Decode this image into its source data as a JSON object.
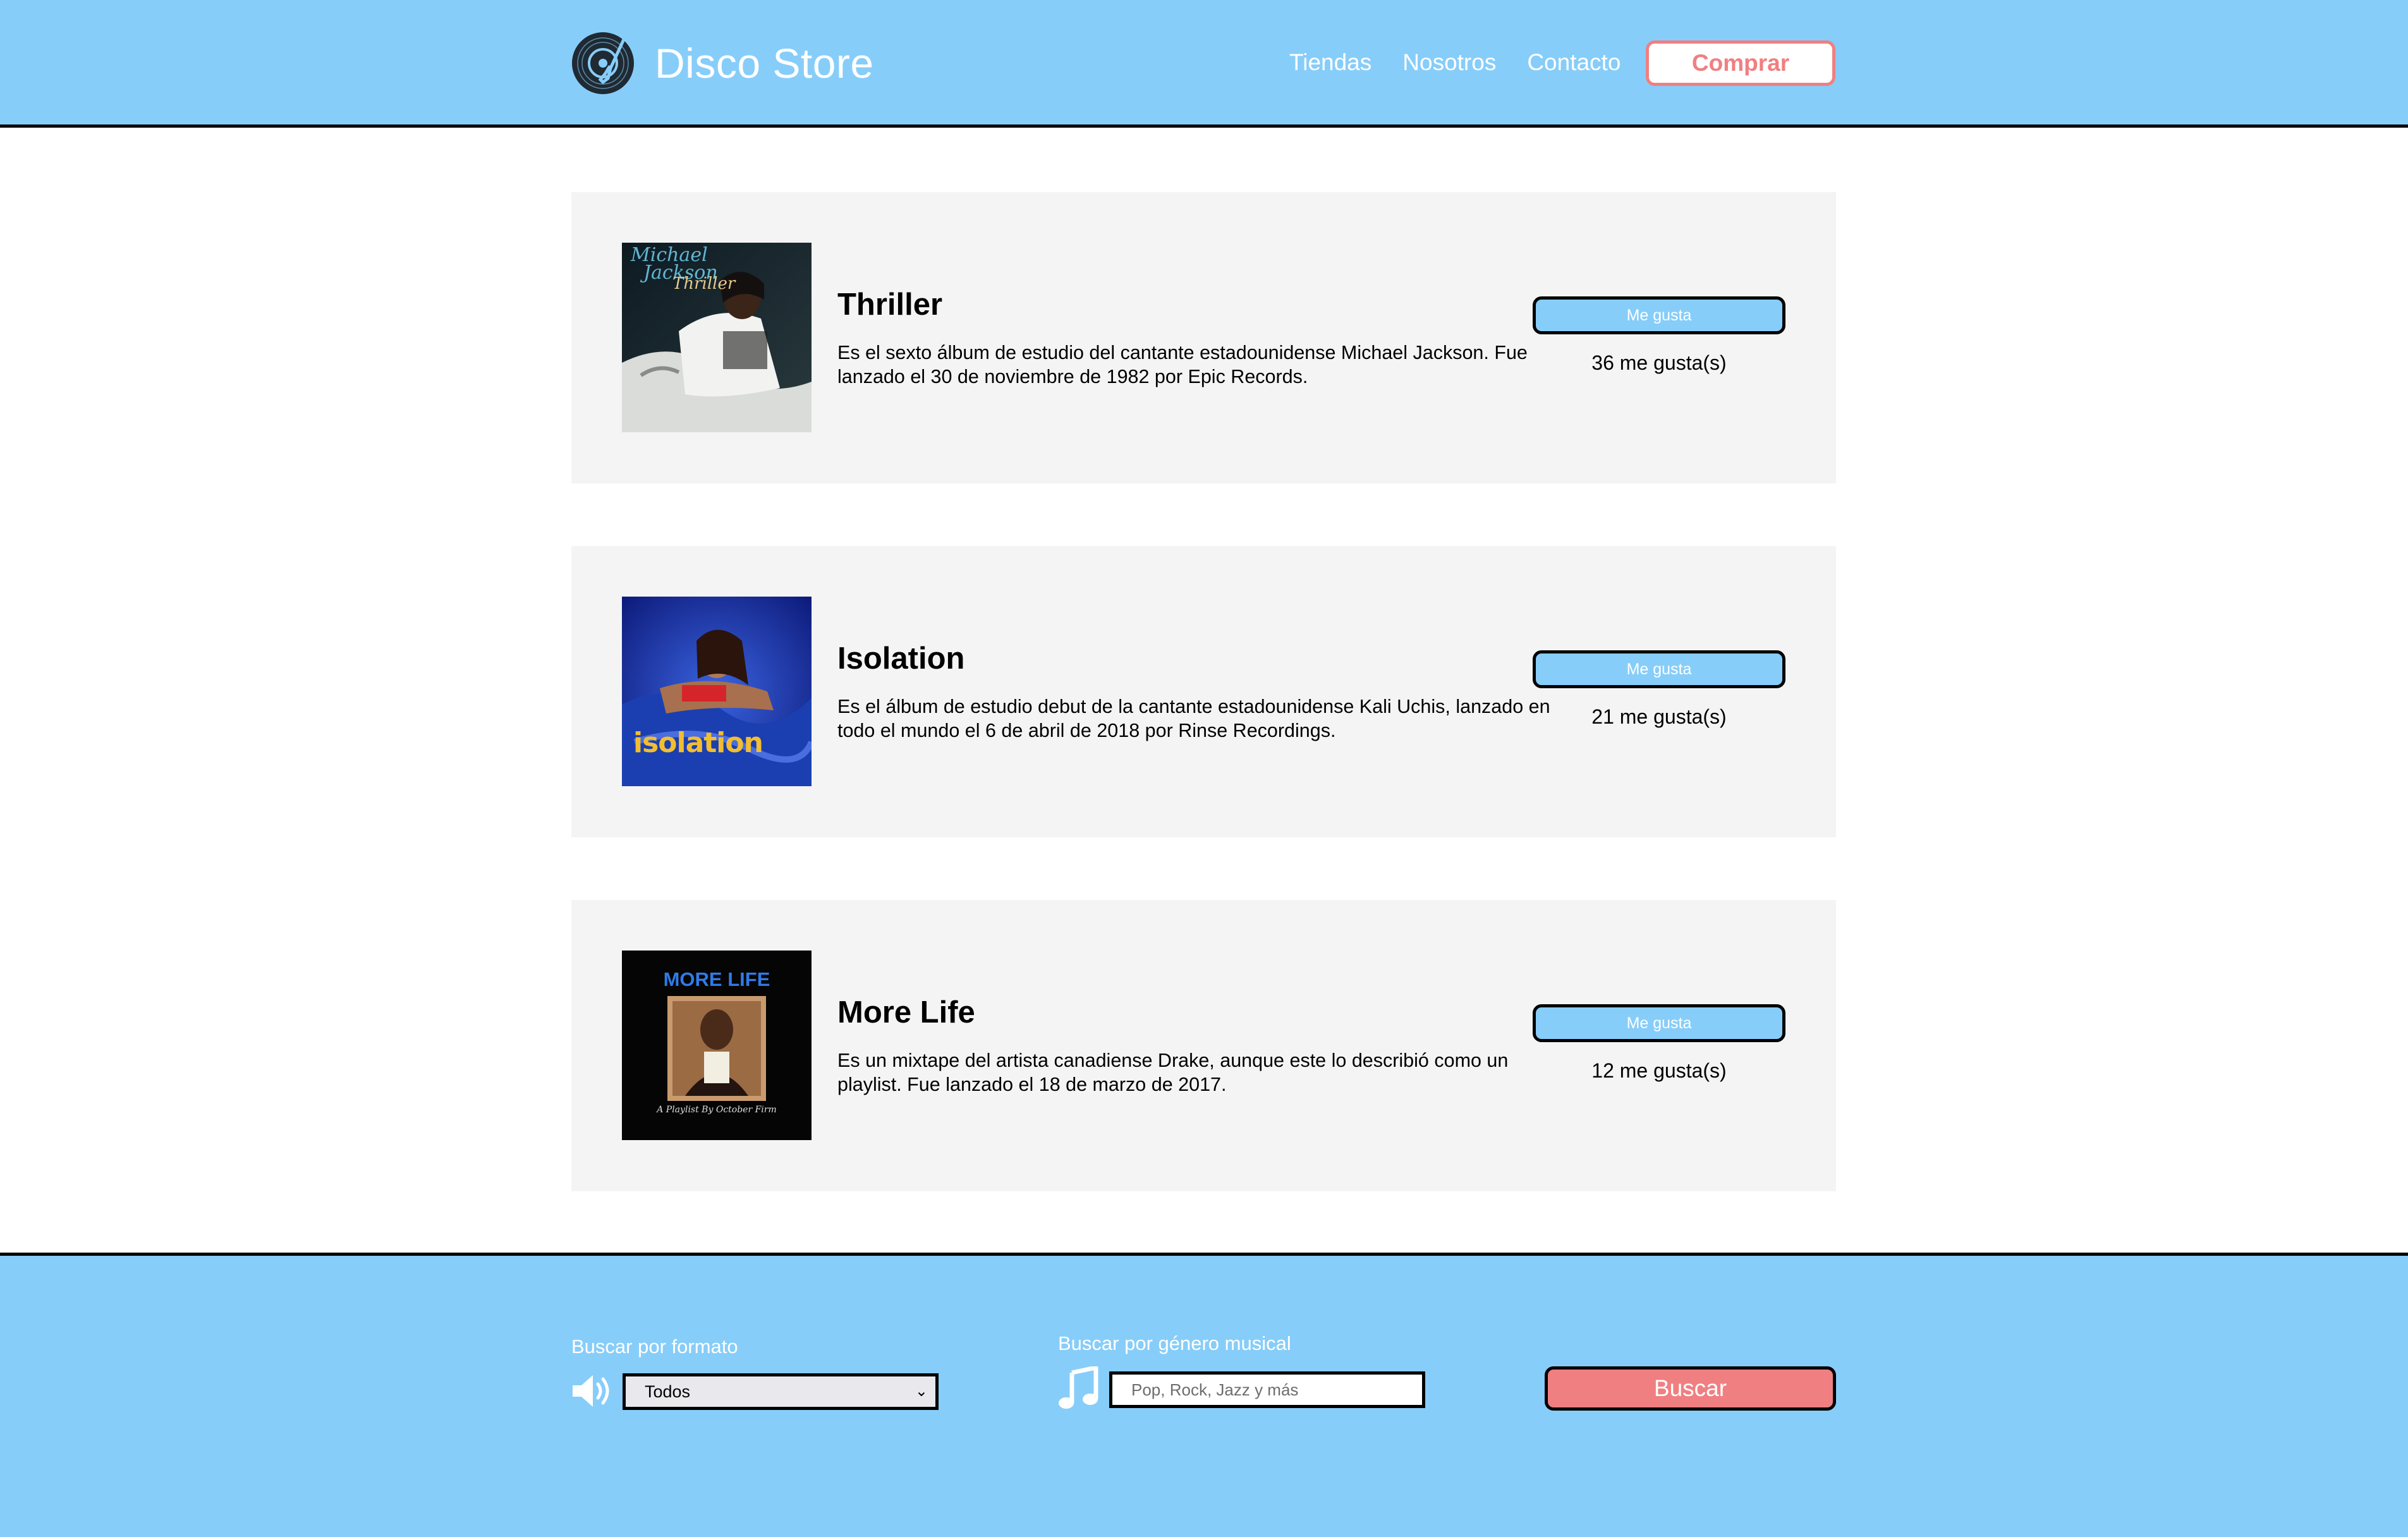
{
  "header": {
    "brand_name": "Disco Store",
    "nav": [
      "Tiendas",
      "Nosotros",
      "Contacto"
    ],
    "cta_label": "Comprar"
  },
  "albums": [
    {
      "title": "Thriller",
      "description": "Es el sexto álbum de estudio del cantante estadounidense Michael Jackson. Fue lanzado el 30 de noviembre de 1982 por Epic Records.",
      "like_label": "Me gusta",
      "likes_text": "36 me gusta(s)",
      "cover_text": [
        "Michael",
        "Jackson",
        "Thriller"
      ]
    },
    {
      "title": "Isolation",
      "description": "Es el álbum de estudio debut de la cantante estadounidense Kali Uchis, lanzado en todo el mundo el 6 de abril de 2018 por Rinse Recordings.",
      "like_label": "Me gusta",
      "likes_text": "21 me gusta(s)",
      "cover_text": [
        "isolation"
      ]
    },
    {
      "title": "More Life",
      "description": "Es un mixtape del artista canadiense Drake, aunque este lo describió como un playlist. Fue lanzado el 18 de marzo de 2017.",
      "like_label": "Me gusta",
      "likes_text": "12 me gusta(s)",
      "cover_text": [
        "MORE LIFE",
        "A Playlist By October Firm"
      ]
    }
  ],
  "footer": {
    "format_label": "Buscar por formato",
    "format_selected": "Todos",
    "genre_label": "Buscar por género musical",
    "genre_placeholder": "Pop, Rock, Jazz y más",
    "search_button": "Buscar"
  },
  "icons": {
    "logo": "vinyl-record-icon",
    "format": "speaker-icon",
    "genre": "music-note-icon",
    "select": "chevron-down-icon"
  },
  "colors": {
    "primary": "#87cdf9",
    "accent": "#f07f81",
    "card_bg": "#f4f4f4",
    "text": "#000000"
  }
}
